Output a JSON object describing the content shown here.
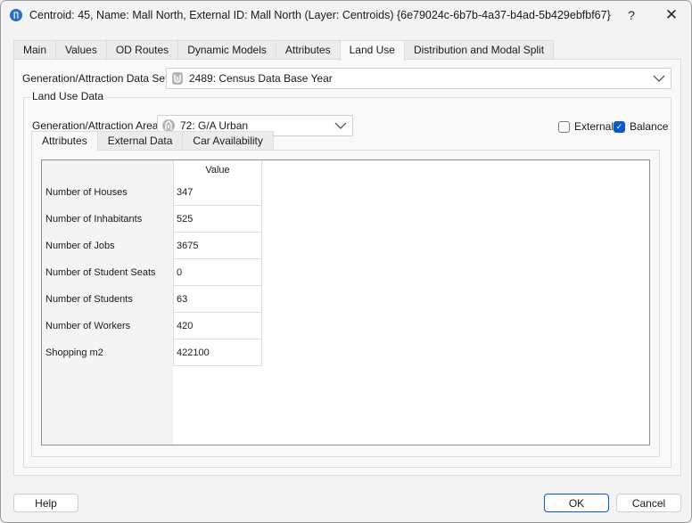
{
  "window": {
    "title": "Centroid: 45, Name: Mall North, External ID: Mall North (Layer: Centroids) {6e79024c-6b7b-4a37-b4ad-5b429ebfbf67}",
    "app_icon_glyph": "∏",
    "help_glyph": "?",
    "close_glyph": "✕"
  },
  "tabs": [
    {
      "label": "Main",
      "active": false
    },
    {
      "label": "Values",
      "active": false
    },
    {
      "label": "OD Routes",
      "active": false
    },
    {
      "label": "Dynamic Models",
      "active": false
    },
    {
      "label": "Attributes",
      "active": false
    },
    {
      "label": "Land Use",
      "active": true
    },
    {
      "label": "Distribution and Modal Split",
      "active": false
    }
  ],
  "data_set": {
    "label": "Generation/Attraction Data Set:",
    "value": "2489: Census Data Base Year",
    "icon": "census-data-icon"
  },
  "land_use": {
    "group_title": "Land Use Data",
    "area_label": "Generation/Attraction Area:",
    "area_value": "72: G/A Urban",
    "area_icon": "urban-area-icon",
    "external": {
      "label": "External",
      "checked": false
    },
    "balance": {
      "label": "Balance",
      "checked": true
    },
    "check_glyph": "✓"
  },
  "subtabs": [
    {
      "label": "Attributes",
      "active": true
    },
    {
      "label": "External Data",
      "active": false
    },
    {
      "label": "Car Availability",
      "active": false
    }
  ],
  "grid": {
    "column_header": "Value",
    "rows": [
      {
        "label": "Number of Houses",
        "value": "347"
      },
      {
        "label": "Number of Inhabitants",
        "value": "525"
      },
      {
        "label": "Number of Jobs",
        "value": "3675"
      },
      {
        "label": "Number of Student Seats",
        "value": "0"
      },
      {
        "label": "Number of Students",
        "value": "63"
      },
      {
        "label": "Number of Workers",
        "value": "420"
      },
      {
        "label": "Shopping m2",
        "value": "422100"
      }
    ]
  },
  "buttons": {
    "help": "Help",
    "ok": "OK",
    "cancel": "Cancel"
  },
  "colors": {
    "accent": "#0a5cc2",
    "app_icon": "#2b6fc2"
  }
}
